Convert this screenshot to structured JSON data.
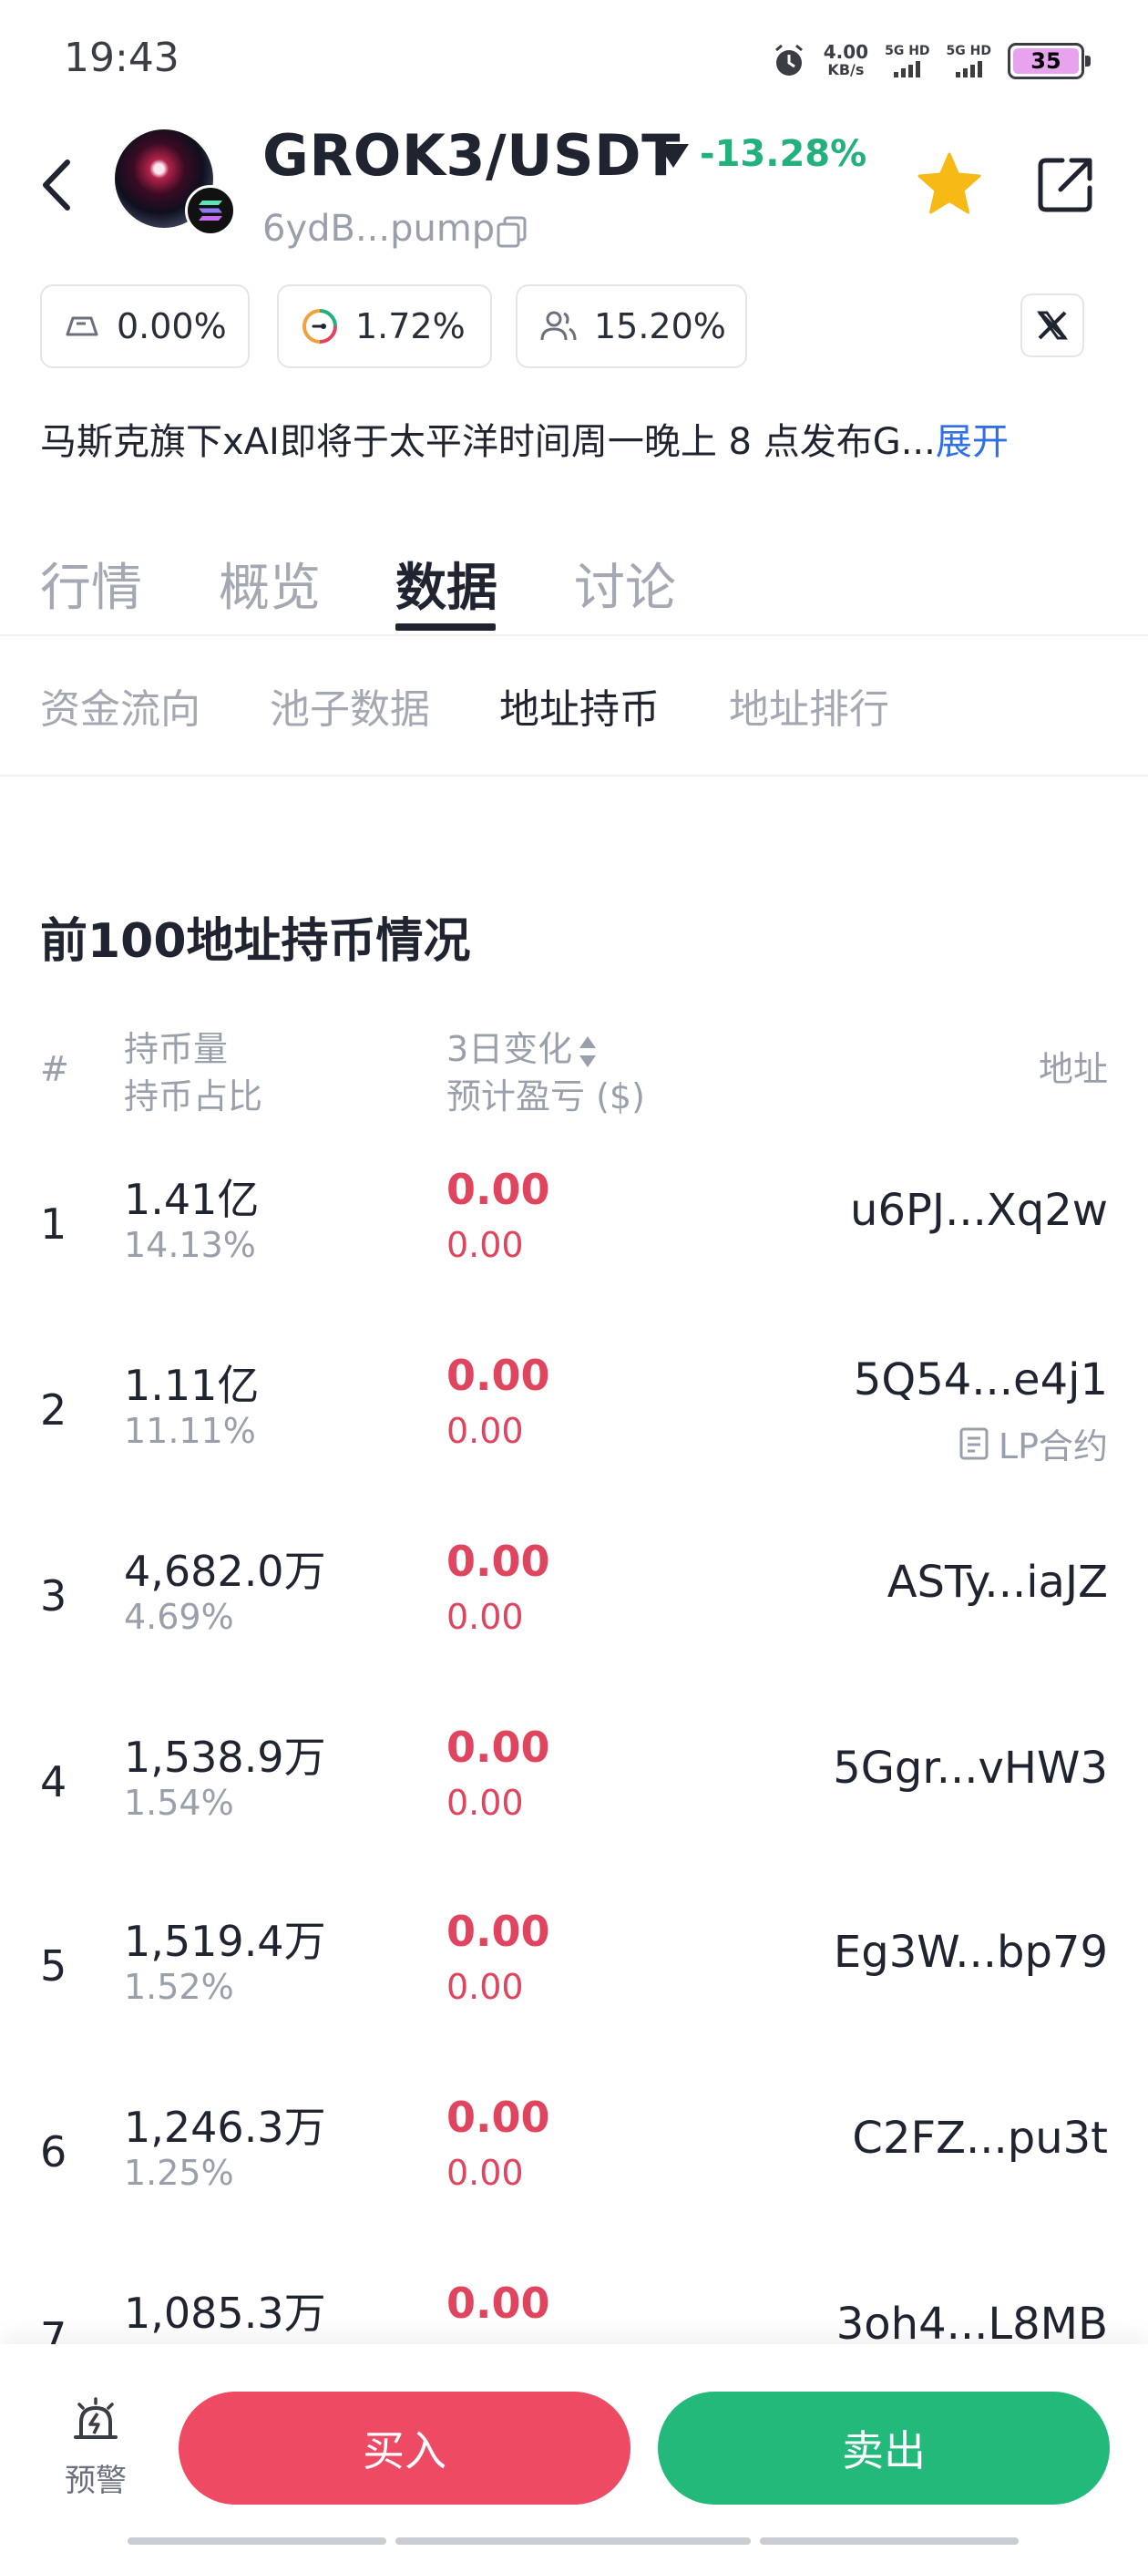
{
  "status_bar": {
    "time": "19:43",
    "speed_value": "4.00",
    "speed_unit": "KB/s",
    "sim1_label": "5G HD",
    "sim2_label": "5G HD",
    "battery": "35"
  },
  "header": {
    "pair": "GROK3/USDT",
    "change_pct": "-13.28%",
    "contract_short": "6ydB...pump",
    "icons": [
      "back-icon",
      "token-avatar",
      "solana-icon",
      "caret-down-icon",
      "copy-icon",
      "star-icon",
      "share-icon"
    ]
  },
  "metrics": [
    {
      "icon": "top10-share-icon",
      "value": "0.00%"
    },
    {
      "icon": "gauge-icon",
      "value": "1.72%"
    },
    {
      "icon": "holders-icon",
      "value": "15.20%"
    }
  ],
  "social": {
    "x_icon": "x-icon"
  },
  "description": {
    "text": "马斯克旗下xAI即将于太平洋时间周一晚上 8 点发布G...",
    "expand_label": "展开"
  },
  "main_tabs": [
    "行情",
    "概览",
    "数据",
    "讨论"
  ],
  "main_tab_active": "数据",
  "sub_tabs": [
    "资金流向",
    "池子数据",
    "地址持币",
    "地址排行"
  ],
  "sub_tab_active": "地址持币",
  "section_title": "前100地址持币情况",
  "table_header": {
    "rank": "#",
    "amount": "持币量",
    "share": "持币占比",
    "change": "3日变化",
    "pnl": "预计盈亏 ($)",
    "address": "地址"
  },
  "rows": [
    {
      "rank": "1",
      "amount": "1.41亿",
      "share": "14.13%",
      "change": "0.00",
      "pnl": "0.00",
      "address": "u6PJ...Xq2w",
      "tag": ""
    },
    {
      "rank": "2",
      "amount": "1.11亿",
      "share": "11.11%",
      "change": "0.00",
      "pnl": "0.00",
      "address": "5Q54...e4j1",
      "tag": "LP合约"
    },
    {
      "rank": "3",
      "amount": "4,682.0万",
      "share": "4.69%",
      "change": "0.00",
      "pnl": "0.00",
      "address": "ASTy...iaJZ",
      "tag": ""
    },
    {
      "rank": "4",
      "amount": "1,538.9万",
      "share": "1.54%",
      "change": "0.00",
      "pnl": "0.00",
      "address": "5Ggr...vHW3",
      "tag": ""
    },
    {
      "rank": "5",
      "amount": "1,519.4万",
      "share": "1.52%",
      "change": "0.00",
      "pnl": "0.00",
      "address": "Eg3W...bp79",
      "tag": ""
    },
    {
      "rank": "6",
      "amount": "1,246.3万",
      "share": "1.25%",
      "change": "0.00",
      "pnl": "0.00",
      "address": "C2FZ...pu3t",
      "tag": ""
    },
    {
      "rank": "7",
      "amount": "1,085.3万",
      "share": "",
      "change": "0.00",
      "pnl": "",
      "address": "3oh4...L8MB",
      "tag": ""
    }
  ],
  "bottom": {
    "alert_label": "预警",
    "buy_label": "买入",
    "sell_label": "卖出"
  },
  "colors": {
    "up_green": "#22b07d",
    "down_red": "#e0455f",
    "buy": "#ee4a63",
    "sell": "#22b97a",
    "link_blue": "#2f6fe8",
    "star": "#f6b916"
  }
}
